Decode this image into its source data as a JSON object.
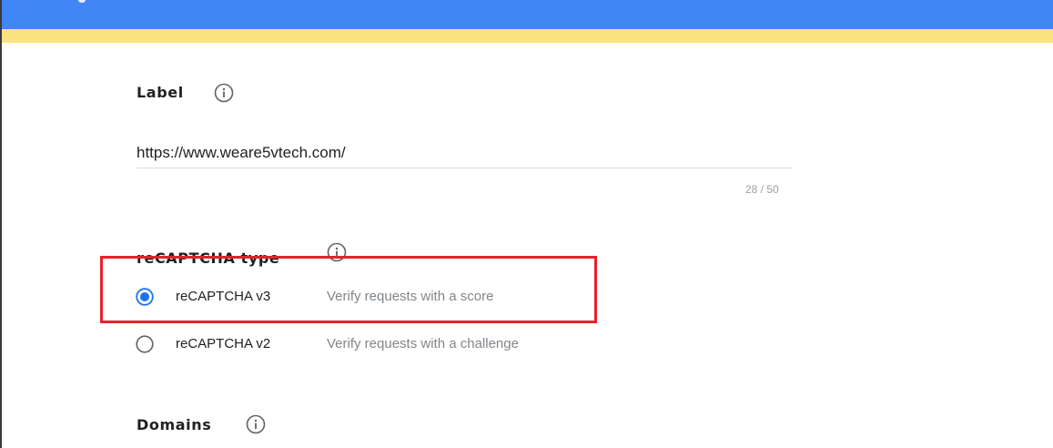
{
  "label_section": {
    "title": "Label",
    "info_icon": "info-icon",
    "value": "https://www.weare5vtech.com/",
    "counter": "28 / 50"
  },
  "recaptcha_section": {
    "title": "reCAPTCHA type",
    "info_icon": "info-icon",
    "options": [
      {
        "label": "reCAPTCHA v3",
        "description": "Verify requests with a score",
        "selected": true
      },
      {
        "label": "reCAPTCHA v2",
        "description": "Verify requests with a challenge",
        "selected": false
      }
    ]
  },
  "domains_section": {
    "title": "Domains",
    "info_icon": "info-icon"
  },
  "colors": {
    "header_blue": "#4285f4",
    "header_yellow": "#fbe37f",
    "radio_selected": "#1a73e8",
    "highlight_red": "#e5222b"
  }
}
